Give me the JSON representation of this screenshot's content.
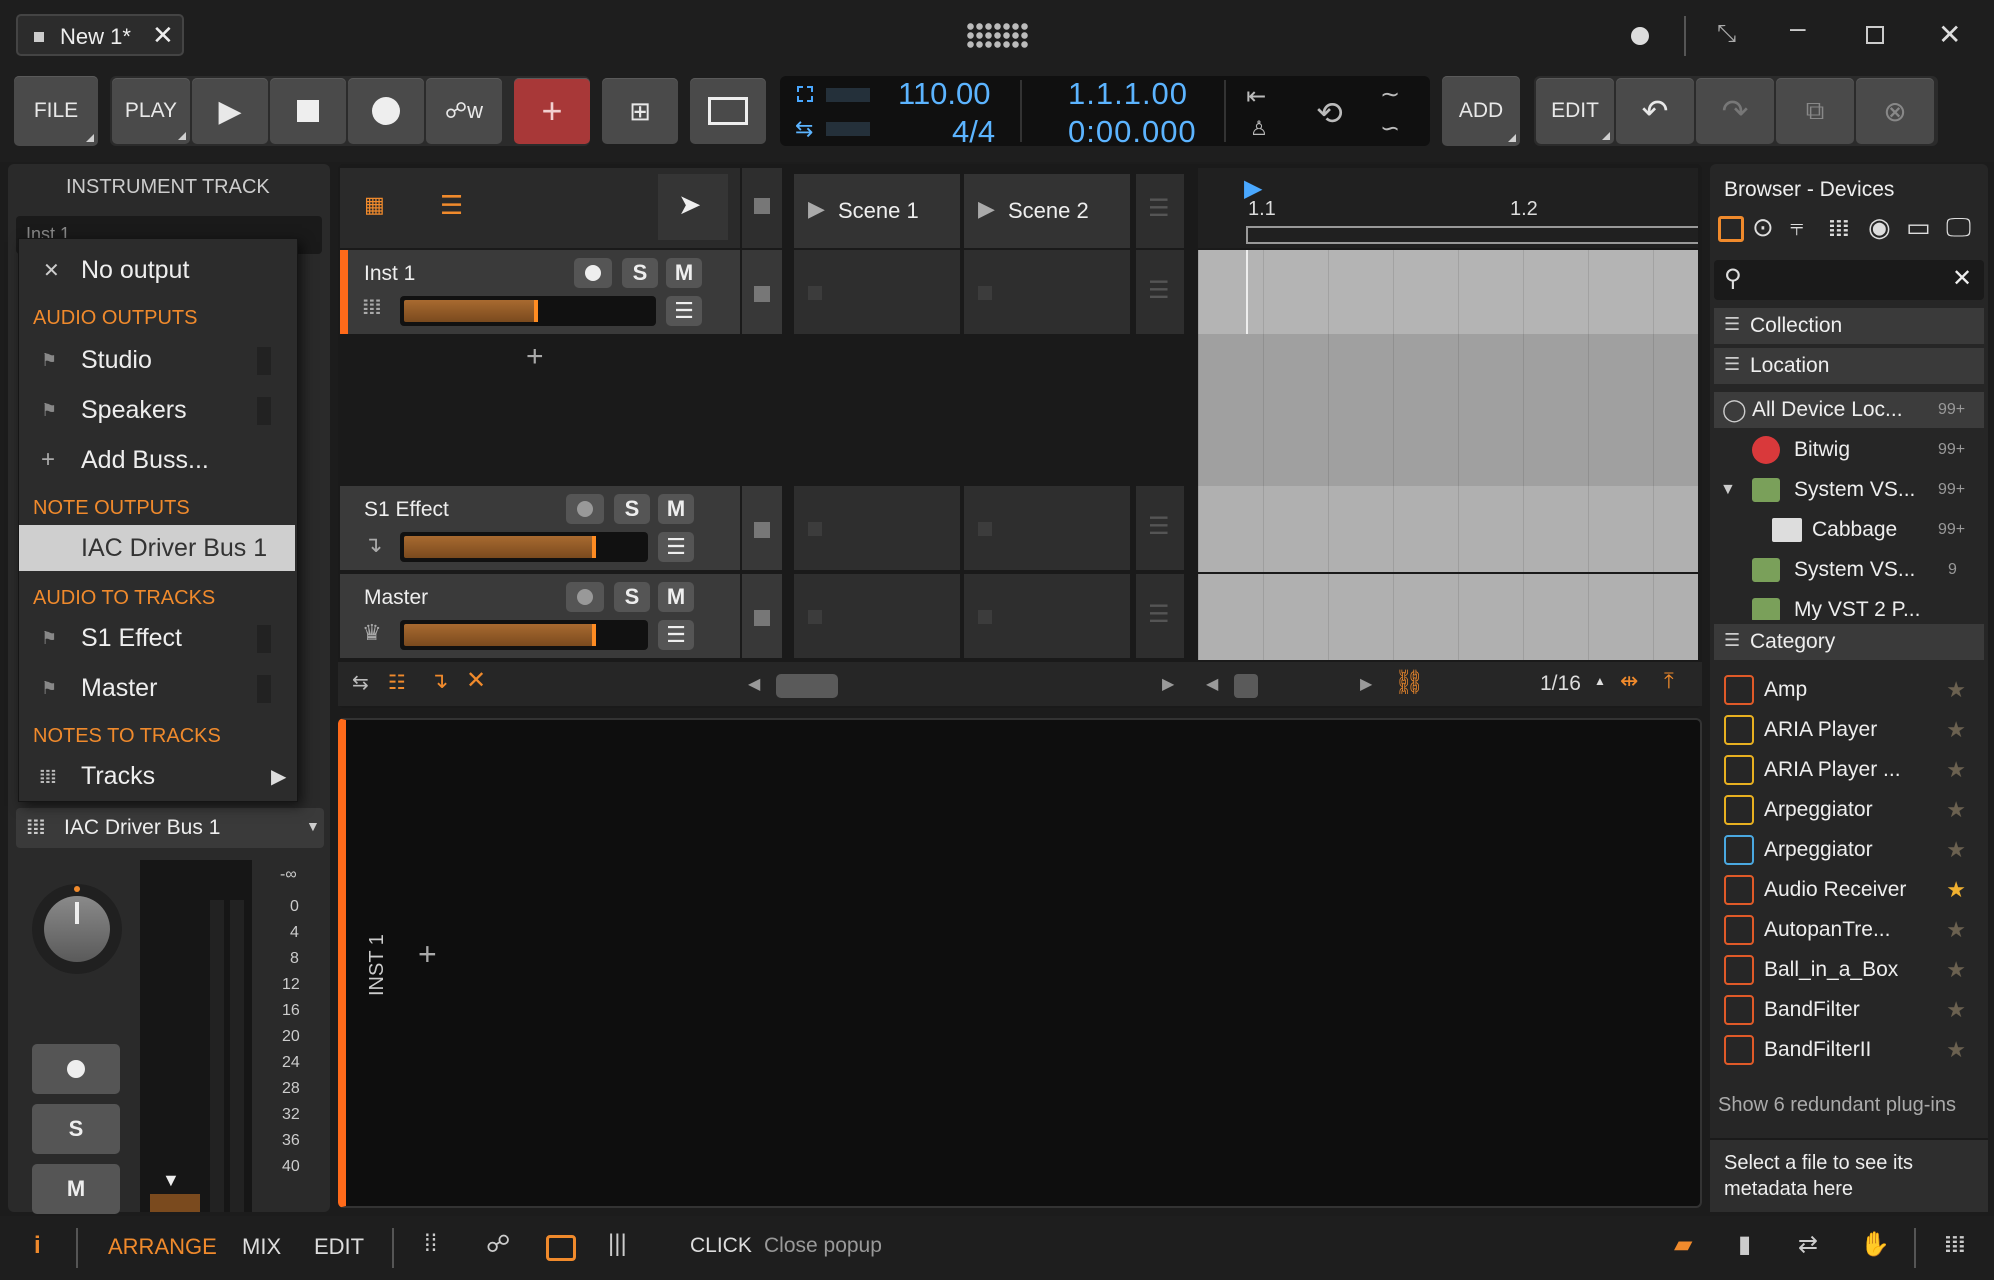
{
  "title_tab": {
    "label": "New 1*"
  },
  "transport": {
    "file": "FILE",
    "play": "PLAY",
    "tempo": "110.00",
    "signature": "4/4",
    "position_bars": "1.1.1.00",
    "position_time": "0:00.000",
    "add": "ADD",
    "edit": "EDIT"
  },
  "inspector": {
    "header": "INSTRUMENT TRACK",
    "name_field": "Inst 1",
    "output_selector": "IAC Driver Bus 1",
    "meter_scale": [
      "-∞",
      "0",
      "4",
      "8",
      "12",
      "16",
      "20",
      "24",
      "28",
      "32",
      "36",
      "40"
    ]
  },
  "popup": {
    "no_output": "No output",
    "sec_audio_outputs": "AUDIO OUTPUTS",
    "studio": "Studio",
    "speakers": "Speakers",
    "add_buss": "Add Buss...",
    "sec_note_outputs": "NOTE OUTPUTS",
    "iac": "IAC Driver Bus 1",
    "sec_audio_to_tracks": "AUDIO TO TRACKS",
    "s1_effect": "S1 Effect",
    "master": "Master",
    "sec_notes_to_tracks": "NOTES TO TRACKS",
    "tracks": "Tracks"
  },
  "tracks": {
    "scene1": "Scene 1",
    "scene2": "Scene 2",
    "inst1": "Inst 1",
    "s1effect": "S1 Effect",
    "master": "Master",
    "s": "S",
    "m": "M"
  },
  "timeline": {
    "m1": "1.1",
    "m2": "1.2",
    "grid": "1/16"
  },
  "detail": {
    "track_label": "INST 1"
  },
  "browser": {
    "title": "Browser - Devices",
    "collection": "Collection",
    "location": "Location",
    "locations": [
      {
        "name": "All Device Loc...",
        "count": "99+"
      },
      {
        "name": "Bitwig",
        "count": "99+"
      },
      {
        "name": "System VS...",
        "count": "99+"
      },
      {
        "name": "Cabbage",
        "count": "99+"
      },
      {
        "name": "System VS...",
        "count": "9"
      },
      {
        "name": "My VST 2 P...",
        "count": ""
      }
    ],
    "category": "Category",
    "devices": [
      "Amp",
      "ARIA Player",
      "ARIA Player ...",
      "Arpeggiator",
      "Arpeggiator",
      "Audio Receiver",
      "AutopanTre...",
      "Ball_in_a_Box",
      "BandFilter",
      "BandFilterII"
    ],
    "redundant": "Show 6 redundant plug-ins",
    "metadata": "Select a file to see its metadata here"
  },
  "footer": {
    "arrange": "ARRANGE",
    "mix": "MIX",
    "edit": "EDIT",
    "click": "CLICK",
    "status": "Close popup"
  }
}
